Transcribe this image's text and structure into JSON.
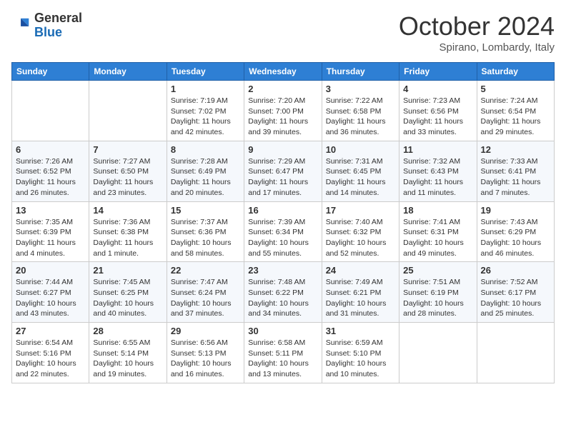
{
  "header": {
    "logo_general": "General",
    "logo_blue": "Blue",
    "month_title": "October 2024",
    "location": "Spirano, Lombardy, Italy"
  },
  "days_of_week": [
    "Sunday",
    "Monday",
    "Tuesday",
    "Wednesday",
    "Thursday",
    "Friday",
    "Saturday"
  ],
  "weeks": [
    [
      {
        "day": "",
        "info": ""
      },
      {
        "day": "",
        "info": ""
      },
      {
        "day": "1",
        "info": "Sunrise: 7:19 AM\nSunset: 7:02 PM\nDaylight: 11 hours and 42 minutes."
      },
      {
        "day": "2",
        "info": "Sunrise: 7:20 AM\nSunset: 7:00 PM\nDaylight: 11 hours and 39 minutes."
      },
      {
        "day": "3",
        "info": "Sunrise: 7:22 AM\nSunset: 6:58 PM\nDaylight: 11 hours and 36 minutes."
      },
      {
        "day": "4",
        "info": "Sunrise: 7:23 AM\nSunset: 6:56 PM\nDaylight: 11 hours and 33 minutes."
      },
      {
        "day": "5",
        "info": "Sunrise: 7:24 AM\nSunset: 6:54 PM\nDaylight: 11 hours and 29 minutes."
      }
    ],
    [
      {
        "day": "6",
        "info": "Sunrise: 7:26 AM\nSunset: 6:52 PM\nDaylight: 11 hours and 26 minutes."
      },
      {
        "day": "7",
        "info": "Sunrise: 7:27 AM\nSunset: 6:50 PM\nDaylight: 11 hours and 23 minutes."
      },
      {
        "day": "8",
        "info": "Sunrise: 7:28 AM\nSunset: 6:49 PM\nDaylight: 11 hours and 20 minutes."
      },
      {
        "day": "9",
        "info": "Sunrise: 7:29 AM\nSunset: 6:47 PM\nDaylight: 11 hours and 17 minutes."
      },
      {
        "day": "10",
        "info": "Sunrise: 7:31 AM\nSunset: 6:45 PM\nDaylight: 11 hours and 14 minutes."
      },
      {
        "day": "11",
        "info": "Sunrise: 7:32 AM\nSunset: 6:43 PM\nDaylight: 11 hours and 11 minutes."
      },
      {
        "day": "12",
        "info": "Sunrise: 7:33 AM\nSunset: 6:41 PM\nDaylight: 11 hours and 7 minutes."
      }
    ],
    [
      {
        "day": "13",
        "info": "Sunrise: 7:35 AM\nSunset: 6:39 PM\nDaylight: 11 hours and 4 minutes."
      },
      {
        "day": "14",
        "info": "Sunrise: 7:36 AM\nSunset: 6:38 PM\nDaylight: 11 hours and 1 minute."
      },
      {
        "day": "15",
        "info": "Sunrise: 7:37 AM\nSunset: 6:36 PM\nDaylight: 10 hours and 58 minutes."
      },
      {
        "day": "16",
        "info": "Sunrise: 7:39 AM\nSunset: 6:34 PM\nDaylight: 10 hours and 55 minutes."
      },
      {
        "day": "17",
        "info": "Sunrise: 7:40 AM\nSunset: 6:32 PM\nDaylight: 10 hours and 52 minutes."
      },
      {
        "day": "18",
        "info": "Sunrise: 7:41 AM\nSunset: 6:31 PM\nDaylight: 10 hours and 49 minutes."
      },
      {
        "day": "19",
        "info": "Sunrise: 7:43 AM\nSunset: 6:29 PM\nDaylight: 10 hours and 46 minutes."
      }
    ],
    [
      {
        "day": "20",
        "info": "Sunrise: 7:44 AM\nSunset: 6:27 PM\nDaylight: 10 hours and 43 minutes."
      },
      {
        "day": "21",
        "info": "Sunrise: 7:45 AM\nSunset: 6:25 PM\nDaylight: 10 hours and 40 minutes."
      },
      {
        "day": "22",
        "info": "Sunrise: 7:47 AM\nSunset: 6:24 PM\nDaylight: 10 hours and 37 minutes."
      },
      {
        "day": "23",
        "info": "Sunrise: 7:48 AM\nSunset: 6:22 PM\nDaylight: 10 hours and 34 minutes."
      },
      {
        "day": "24",
        "info": "Sunrise: 7:49 AM\nSunset: 6:21 PM\nDaylight: 10 hours and 31 minutes."
      },
      {
        "day": "25",
        "info": "Sunrise: 7:51 AM\nSunset: 6:19 PM\nDaylight: 10 hours and 28 minutes."
      },
      {
        "day": "26",
        "info": "Sunrise: 7:52 AM\nSunset: 6:17 PM\nDaylight: 10 hours and 25 minutes."
      }
    ],
    [
      {
        "day": "27",
        "info": "Sunrise: 6:54 AM\nSunset: 5:16 PM\nDaylight: 10 hours and 22 minutes."
      },
      {
        "day": "28",
        "info": "Sunrise: 6:55 AM\nSunset: 5:14 PM\nDaylight: 10 hours and 19 minutes."
      },
      {
        "day": "29",
        "info": "Sunrise: 6:56 AM\nSunset: 5:13 PM\nDaylight: 10 hours and 16 minutes."
      },
      {
        "day": "30",
        "info": "Sunrise: 6:58 AM\nSunset: 5:11 PM\nDaylight: 10 hours and 13 minutes."
      },
      {
        "day": "31",
        "info": "Sunrise: 6:59 AM\nSunset: 5:10 PM\nDaylight: 10 hours and 10 minutes."
      },
      {
        "day": "",
        "info": ""
      },
      {
        "day": "",
        "info": ""
      }
    ]
  ]
}
